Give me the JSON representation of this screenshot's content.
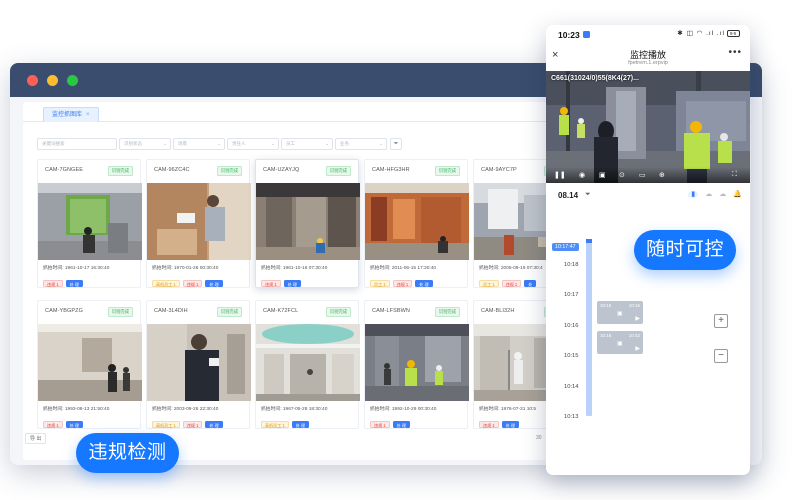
{
  "desktop": {
    "tab": {
      "label": "监控抓图库",
      "close": "×"
    },
    "filters": [
      {
        "placeholder": "关键词搜索",
        "caret": ""
      },
      {
        "placeholder": "识别状态",
        "caret": "⌄"
      },
      {
        "placeholder": "场景",
        "caret": "⌄"
      },
      {
        "placeholder": "责任人",
        "caret": "⌄"
      },
      {
        "placeholder": "员工",
        "caret": "⌄"
      },
      {
        "placeholder": "业务",
        "caret": "⌄"
      }
    ],
    "filter_icon": "funnel-icon",
    "cards": [
      {
        "cam": "CAM-7GNGEE",
        "badge": "识别完成",
        "time": "抓拍时间: 1961-10-17 16:30:40",
        "tags": [
          {
            "text": "违规 1",
            "kind": "red"
          },
          {
            "text": "处 理",
            "kind": "blue"
          }
        ]
      },
      {
        "cam": "CAM-96ZC4C",
        "badge": "识别完成",
        "time": "抓拍时间: 1970-01-26 00:30:40",
        "tags": [
          {
            "text": "高低员工 1",
            "kind": "yellow"
          },
          {
            "text": "违规 1",
            "kind": "red"
          },
          {
            "text": "处 理",
            "kind": "blue"
          }
        ]
      },
      {
        "cam": "CAM-UZAYJQ",
        "badge": "识别完成",
        "time": "抓拍时间: 1961-10-16 07:30:40",
        "tags": [
          {
            "text": "违规 1",
            "kind": "red"
          },
          {
            "text": "处 理",
            "kind": "blue"
          }
        ]
      },
      {
        "cam": "CAM-HFG3HR",
        "badge": "识别完成",
        "time": "抓拍时间: 2011-06-15 17:30:40",
        "tags": [
          {
            "text": "员工 1",
            "kind": "yellow"
          },
          {
            "text": "违规 1",
            "kind": "red"
          },
          {
            "text": "处 理",
            "kind": "blue"
          }
        ]
      },
      {
        "cam": "CAM-9AYC7P",
        "badge": "识别完成",
        "time": "抓拍时间: 2005-09-19 07:30:4",
        "tags": [
          {
            "text": "员工 1",
            "kind": "yellow"
          },
          {
            "text": "违规 1",
            "kind": "red"
          },
          {
            "text": "处",
            "kind": "blue"
          }
        ]
      },
      {
        "cam": "CAM-YBGPZG",
        "badge": "识别完成",
        "time": "抓拍时间: 1993-08-13 21:50:40",
        "tags": [
          {
            "text": "违规 1",
            "kind": "red"
          },
          {
            "text": "处 理",
            "kind": "blue"
          }
        ]
      },
      {
        "cam": "CAM-3L4DIH",
        "badge": "识别完成",
        "time": "抓拍时间: 2003-09-26 22:30:40",
        "tags": [
          {
            "text": "高低员工 1",
            "kind": "yellow"
          },
          {
            "text": "违规 1",
            "kind": "red"
          },
          {
            "text": "处 理",
            "kind": "blue"
          }
        ]
      },
      {
        "cam": "CAM-K72FCL",
        "badge": "识别完成",
        "time": "抓拍时间: 1967-05-28 18:30:40",
        "tags": [
          {
            "text": "高低员工 1",
            "kind": "yellow"
          },
          {
            "text": "处 理",
            "kind": "blue"
          }
        ]
      },
      {
        "cam": "CAM-LFSBWN",
        "badge": "识别完成",
        "time": "抓拍时间: 1992-10-29 00:30:40",
        "tags": [
          {
            "text": "违规 1",
            "kind": "red"
          },
          {
            "text": "处 理",
            "kind": "blue"
          }
        ]
      },
      {
        "cam": "CAM-BLI32H",
        "badge": "识别完成",
        "time": "抓拍时间: 1976-07-31 10:5",
        "tags": [
          {
            "text": "违规 1",
            "kind": "red"
          },
          {
            "text": "处 理",
            "kind": "blue"
          }
        ]
      }
    ],
    "pager_left": "导 出",
    "pager_right": "30"
  },
  "callouts": {
    "left": "违规检测",
    "right": "随时可控"
  },
  "phone": {
    "clock": "10:23",
    "sys_icons": "✱ ◫ ◠ .ıl .ıl",
    "battery": "99",
    "title": "监控播放",
    "url": "fpetrem.1.erpvip",
    "close": "×",
    "more": "•••",
    "osd": "C661(31024/0)55(8K4(27)...",
    "video_controls": [
      "❚❚",
      "◉",
      "▣",
      "⊙",
      "▭",
      "⊕",
      "⛶"
    ],
    "date": "08.14",
    "funnel": "⏷",
    "view_icons": [
      {
        "icon": "▮",
        "active": true
      },
      {
        "icon": "☁",
        "active": false
      },
      {
        "icon": "☁",
        "active": false
      },
      {
        "icon": "🔔",
        "active": false
      }
    ],
    "times": [
      "10:18",
      "10:17",
      "10:16",
      "10:15",
      "10:14",
      "10:13"
    ],
    "cursor": "10:17:47",
    "clips": [
      {
        "start": "10:16",
        "end": "10:16"
      },
      {
        "start": "10:16",
        "end": "10:42"
      }
    ],
    "zoom_in": "+",
    "zoom_out": "−"
  }
}
